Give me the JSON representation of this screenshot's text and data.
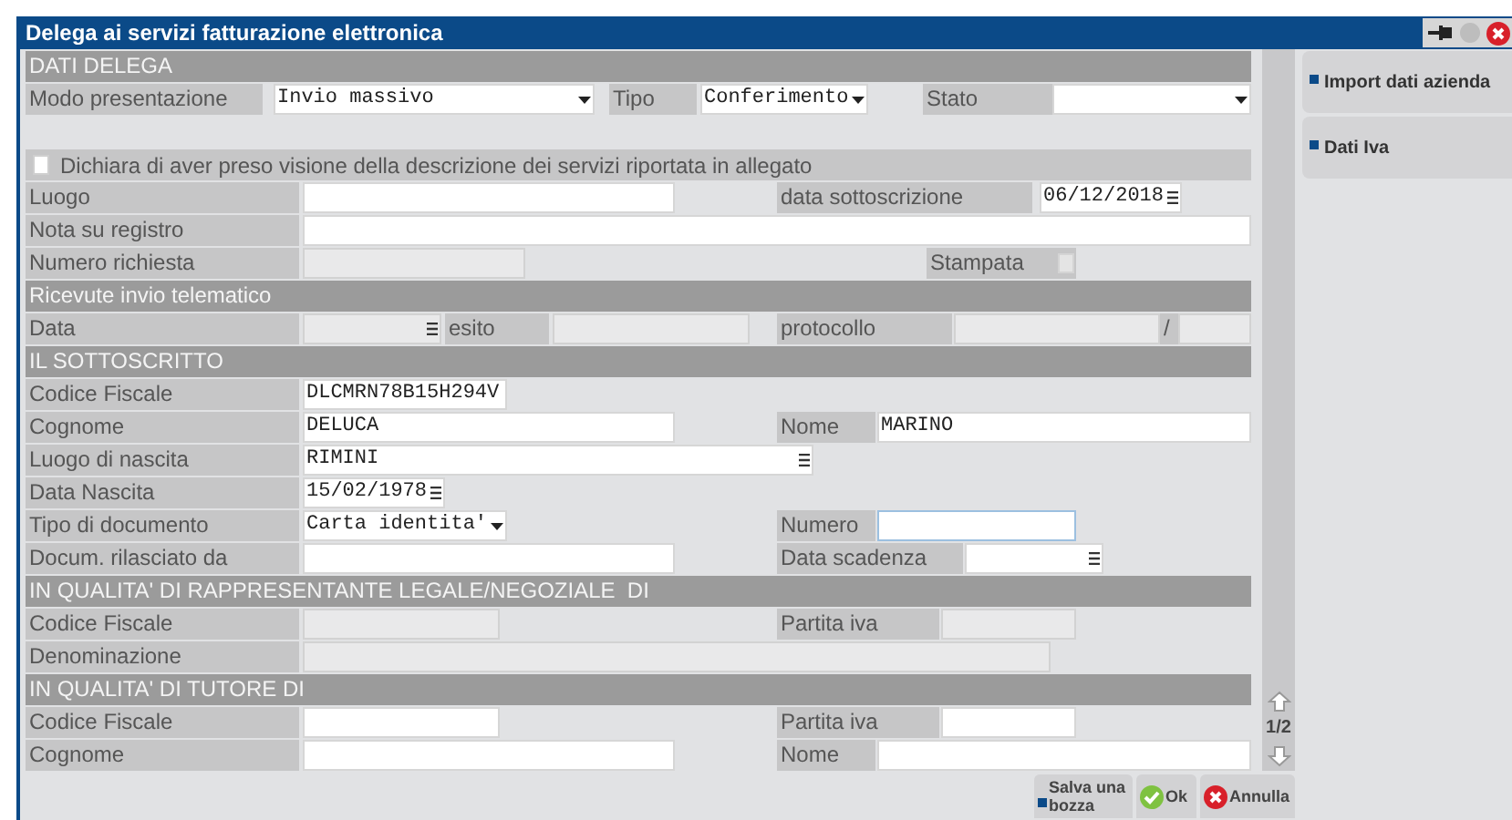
{
  "window": {
    "title": "Delega ai servizi fatturazione elettronica"
  },
  "sections": [
    {
      "title": "DATI DELEGA",
      "rows": [
        [
          {
            "kind": "label",
            "text": "Modo presentazione"
          },
          {
            "kind": "select",
            "value": "Invio massivo",
            "disabled": false
          },
          {
            "kind": "label",
            "text": "Tipo"
          },
          {
            "kind": "select",
            "value": "Conferimento",
            "disabled": false
          },
          {
            "kind": "label",
            "text": "Stato"
          },
          {
            "kind": "select",
            "disabled": false
          }
        ],
        [
          {
            "kind": "checkbox",
            "label": "Dichiara di aver preso visione della descrizione dei servizi riportata in allegato",
            "checked": false,
            "disabled": false
          }
        ],
        [
          {
            "kind": "label",
            "text": "Luogo"
          },
          {
            "kind": "input",
            "disabled": false,
            "focused": false
          },
          {
            "kind": "label",
            "text": "data sottoscrizione"
          },
          {
            "kind": "date",
            "value": "06/12/2018",
            "disabled": false
          }
        ],
        [
          {
            "kind": "label",
            "text": "Nota su registro"
          },
          {
            "kind": "input",
            "disabled": false,
            "focused": false
          }
        ],
        [
          {
            "kind": "label",
            "text": "Numero richiesta"
          },
          {
            "kind": "input",
            "disabled": true,
            "focused": false
          },
          {
            "kind": "label",
            "text": "Stampata"
          },
          {
            "kind": "checkbox",
            "checked": false,
            "disabled": true
          }
        ]
      ]
    },
    {
      "title": "Ricevute invio telematico",
      "rows": [
        [
          {
            "kind": "label",
            "text": "Data"
          },
          {
            "kind": "date",
            "disabled": true
          },
          {
            "kind": "label",
            "text": "esito"
          },
          {
            "kind": "input",
            "disabled": true,
            "focused": false
          },
          {
            "kind": "label",
            "text": "protocollo"
          },
          {
            "kind": "input",
            "disabled": true,
            "focused": false
          },
          {
            "kind": "label",
            "text": "/"
          },
          {
            "kind": "input",
            "disabled": true,
            "focused": false
          }
        ]
      ]
    },
    {
      "title": "IL SOTTOSCRITTO",
      "rows": [
        [
          {
            "kind": "label",
            "text": "Codice Fiscale"
          },
          {
            "kind": "input",
            "value": "DLCMRN78B15H294V",
            "disabled": false,
            "focused": false
          }
        ],
        [
          {
            "kind": "label",
            "text": "Cognome"
          },
          {
            "kind": "input",
            "value": "DELUCA",
            "disabled": false,
            "focused": false
          },
          {
            "kind": "label",
            "text": "Nome"
          },
          {
            "kind": "input",
            "value": "MARINO",
            "disabled": false,
            "focused": false
          }
        ],
        [
          {
            "kind": "label",
            "text": "Luogo di nascita"
          },
          {
            "kind": "lookup",
            "value": "RIMINI",
            "disabled": false
          }
        ],
        [
          {
            "kind": "label",
            "text": "Data Nascita"
          },
          {
            "kind": "date",
            "value": "15/02/1978",
            "disabled": false
          }
        ],
        [
          {
            "kind": "label",
            "text": "Tipo di documento"
          },
          {
            "kind": "select",
            "value": "Carta identita'",
            "disabled": false
          },
          {
            "kind": "label",
            "text": "Numero"
          },
          {
            "kind": "input",
            "disabled": false,
            "focused": true
          }
        ],
        [
          {
            "kind": "label",
            "text": "Docum. rilasciato da"
          },
          {
            "kind": "input",
            "disabled": false,
            "focused": false
          },
          {
            "kind": "label",
            "text": "Data scadenza"
          },
          {
            "kind": "date",
            "disabled": false
          }
        ]
      ]
    },
    {
      "title": "IN QUALITA' DI RAPPRESENTANTE LEGALE/NEGOZIALE  DI",
      "rows": [
        [
          {
            "kind": "label",
            "text": "Codice Fiscale"
          },
          {
            "kind": "input",
            "disabled": true,
            "focused": false
          },
          {
            "kind": "label",
            "text": "Partita iva"
          },
          {
            "kind": "input",
            "disabled": true,
            "focused": false
          }
        ],
        [
          {
            "kind": "label",
            "text": "Denominazione"
          },
          {
            "kind": "input",
            "disabled": true,
            "focused": false
          }
        ]
      ]
    },
    {
      "title": "IN QUALITA' DI TUTORE DI",
      "rows": [
        [
          {
            "kind": "label",
            "text": "Codice Fiscale"
          },
          {
            "kind": "input",
            "disabled": false,
            "focused": false
          },
          {
            "kind": "label",
            "text": "Partita iva"
          },
          {
            "kind": "input",
            "disabled": false,
            "focused": false
          }
        ],
        [
          {
            "kind": "label",
            "text": "Cognome"
          },
          {
            "kind": "input",
            "disabled": false,
            "focused": false
          },
          {
            "kind": "label",
            "text": "Nome"
          },
          {
            "kind": "input",
            "disabled": false,
            "focused": false
          }
        ]
      ]
    }
  ],
  "pager": {
    "text": "1/2"
  },
  "side_buttons": [
    "Import dati azienda",
    "Dati Iva"
  ],
  "buttons": [
    {
      "kind": "draft",
      "label": "Salva una bozza"
    },
    {
      "kind": "ok",
      "label": "Ok"
    },
    {
      "kind": "cancel",
      "label": "Annulla"
    }
  ]
}
